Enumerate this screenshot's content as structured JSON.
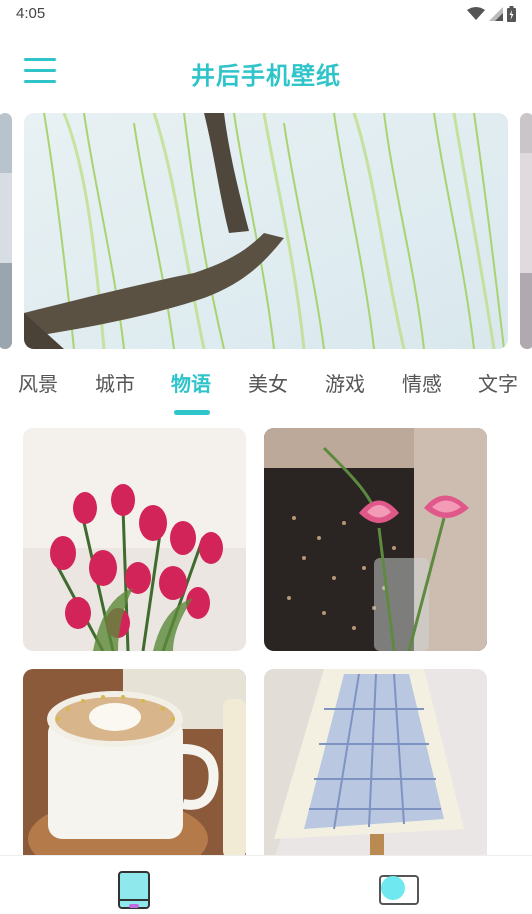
{
  "status_bar": {
    "time": "4:05",
    "icons": [
      "wifi-icon",
      "signal-icon",
      "battery-icon"
    ]
  },
  "header": {
    "title": "井后手机壁纸",
    "menu_icon": "menu-icon"
  },
  "banner": {
    "image": "willow-tree-wallpaper"
  },
  "categories": {
    "items": [
      "风景",
      "城市",
      "物语",
      "美女",
      "游戏",
      "情感",
      "文字"
    ],
    "selected": "物语"
  },
  "wallpapers": [
    {
      "image": "pink-tulips"
    },
    {
      "image": "lotus-in-vase"
    },
    {
      "image": "latte-art-cup"
    },
    {
      "image": "plaid-lamp"
    }
  ],
  "bottom_nav": {
    "items": [
      {
        "icon": "phone-wallpaper-icon",
        "active": true
      },
      {
        "icon": "screen-toggle-icon",
        "active": false
      }
    ]
  },
  "colors": {
    "accent": "#2ec4c9",
    "text": "#555555",
    "background": "#ffffff"
  }
}
